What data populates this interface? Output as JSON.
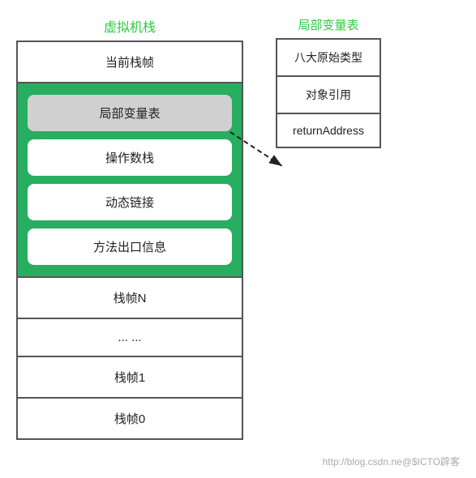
{
  "virtual_stack": {
    "label": "虚拟机栈",
    "current_frame": "当前栈帧",
    "green_frame": {
      "local_vars_box": "局部变量表",
      "operand_stack": "操作数栈",
      "dynamic_link": "动态链接",
      "method_exit": "方法出口信息"
    },
    "frame_n": "栈帧N",
    "frame_dots": "... ...",
    "frame_1": "栈帧1",
    "frame_0": "栈帧0"
  },
  "local_var_table": {
    "label": "局部变量表",
    "rows": [
      "八大原始类型",
      "对象引用",
      "returnAddress"
    ]
  },
  "watermark": "http://blog.csdn.ne@$ICTO辟客"
}
